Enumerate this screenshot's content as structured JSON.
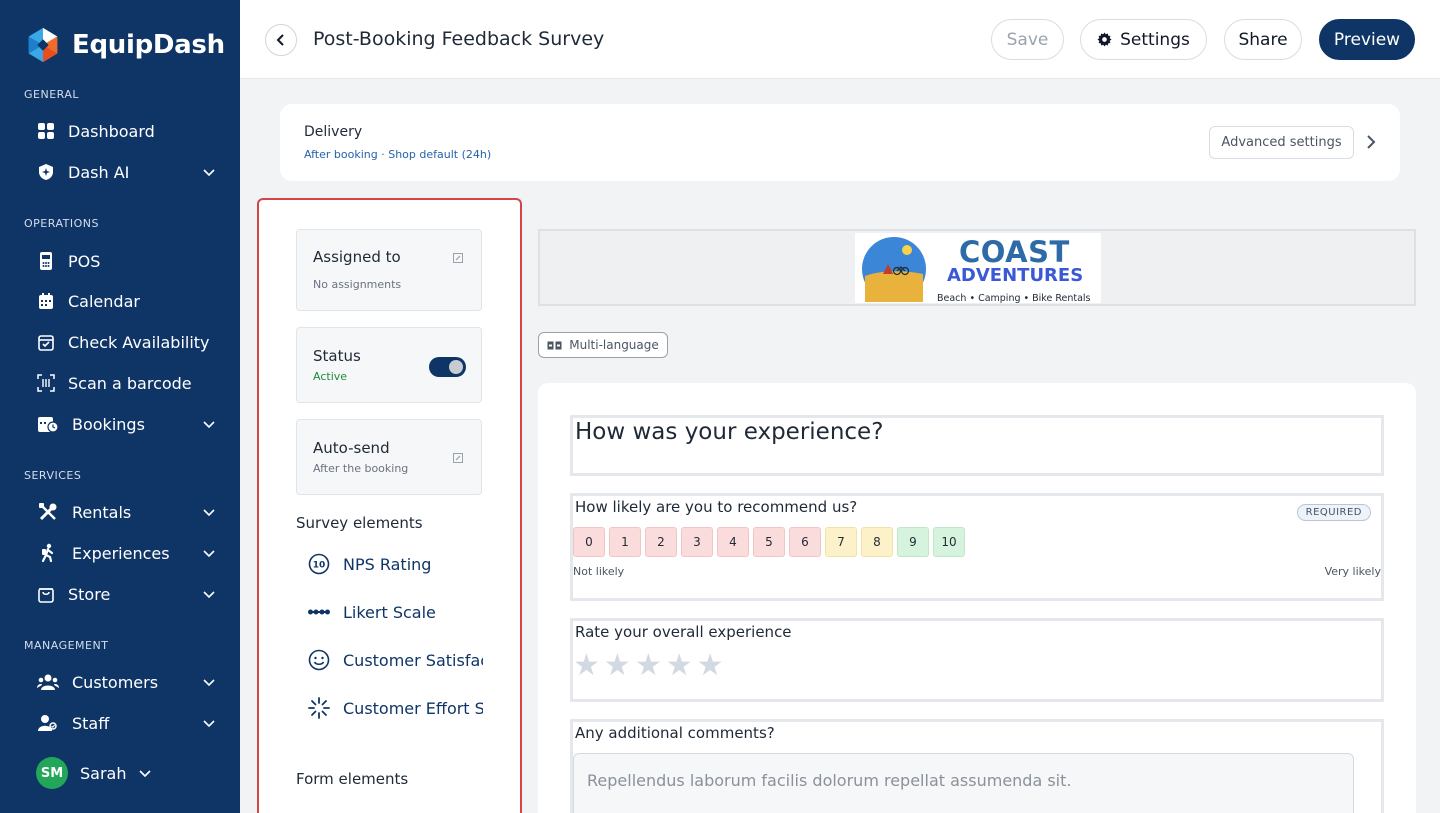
{
  "app": {
    "name": "EquipDash"
  },
  "sidebar": {
    "sections": [
      "GENERAL",
      "OPERATIONS",
      "SERVICES",
      "MANAGEMENT"
    ],
    "items": [
      {
        "label": "Dashboard",
        "icon": "grid-icon"
      },
      {
        "label": "Dash AI",
        "icon": "sparkle-shield-icon",
        "expandable": true
      },
      {
        "label": "POS",
        "icon": "pos-terminal-icon"
      },
      {
        "label": "Calendar",
        "icon": "calendar-icon"
      },
      {
        "label": "Check Availability",
        "icon": "calendar-check-icon"
      },
      {
        "label": "Scan a barcode",
        "icon": "barcode-scan-icon"
      },
      {
        "label": "Bookings",
        "icon": "calendar-clock-icon",
        "expandable": true
      },
      {
        "label": "Rentals",
        "icon": "tools-icon",
        "expandable": true
      },
      {
        "label": "Experiences",
        "icon": "hiker-icon",
        "expandable": true
      },
      {
        "label": "Store",
        "icon": "bag-icon",
        "expandable": true
      },
      {
        "label": "Customers",
        "icon": "users-icon",
        "expandable": true
      },
      {
        "label": "Staff",
        "icon": "staff-icon",
        "expandable": true
      }
    ],
    "user": {
      "initials": "SM",
      "name": "Sarah",
      "avatar_color": "#22a75a"
    }
  },
  "header": {
    "title": "Post-Booking Feedback Survey",
    "save_label": "Save",
    "settings_label": "Settings",
    "share_label": "Share",
    "preview_label": "Preview"
  },
  "delivery": {
    "title": "Delivery",
    "subtitle": "After booking · Shop default (24h)",
    "advanced_label": "Advanced settings"
  },
  "panel": {
    "assigned": {
      "title": "Assigned to",
      "value": "No assignments"
    },
    "status": {
      "title": "Status",
      "value": "Active",
      "enabled": true
    },
    "autosend": {
      "title": "Auto-send",
      "value": "After the booking"
    },
    "survey_elements_title": "Survey elements",
    "survey_elements": [
      {
        "label": "NPS Rating",
        "icon": "nps-10-icon"
      },
      {
        "label": "Likert Scale",
        "icon": "likert-scale-icon"
      },
      {
        "label": "Customer Satisfaction",
        "icon": "smiley-icon"
      },
      {
        "label": "Customer Effort Score",
        "icon": "effort-burst-icon"
      }
    ],
    "form_elements_title": "Form elements"
  },
  "preview": {
    "logo": {
      "title": "COAST",
      "subtitle": "ADVENTURES",
      "tagline": "Beach • Camping • Bike Rentals"
    },
    "multilanguage_label": "Multi-language",
    "heading": "How was your experience?",
    "nps": {
      "question": "How likely are you to recommend us?",
      "required_label": "REQUIRED",
      "scale": [
        "0",
        "1",
        "2",
        "3",
        "4",
        "5",
        "6",
        "7",
        "8",
        "9",
        "10"
      ],
      "low_label": "Not likely",
      "high_label": "Very likely"
    },
    "rating": {
      "question": "Rate your overall experience",
      "stars": 5
    },
    "comments": {
      "question": "Any additional comments?",
      "placeholder": "Repellendus laborum facilis dolorum repellat assumenda sit."
    }
  },
  "colors": {
    "sidebar_bg": "#0f3567",
    "primary": "#0f3567",
    "panel_highlight": "#d64545",
    "status_active": "#1f8a3b"
  }
}
